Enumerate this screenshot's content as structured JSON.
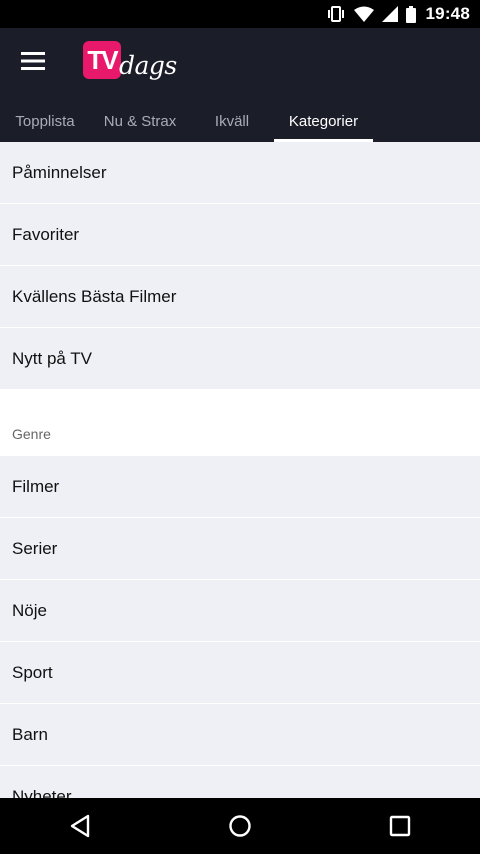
{
  "status_bar": {
    "time": "19:48",
    "icons": [
      "vibrate-icon",
      "wifi-icon",
      "signal-icon",
      "battery-icon"
    ]
  },
  "app_bar": {
    "logo_box_text": "TV",
    "logo_script_text": "dags",
    "background": "#1b1d29",
    "brand_color": "#e8196a"
  },
  "tabs": [
    {
      "label": "Topplista",
      "active": false
    },
    {
      "label": "Nu & Strax",
      "active": false
    },
    {
      "label": "Ikväll",
      "active": false
    },
    {
      "label": "Kategorier",
      "active": true
    }
  ],
  "list": {
    "top_items": [
      "Påminnelser",
      "Favoriter",
      "Kvällens Bästa Filmer",
      "Nytt på TV"
    ],
    "genre_header": "Genre",
    "genre_items": [
      "Filmer",
      "Serier",
      "Nöje",
      "Sport",
      "Barn",
      "Nyheter"
    ]
  },
  "nav_bar": {
    "icons": [
      "back-icon",
      "home-icon",
      "recents-icon"
    ]
  }
}
